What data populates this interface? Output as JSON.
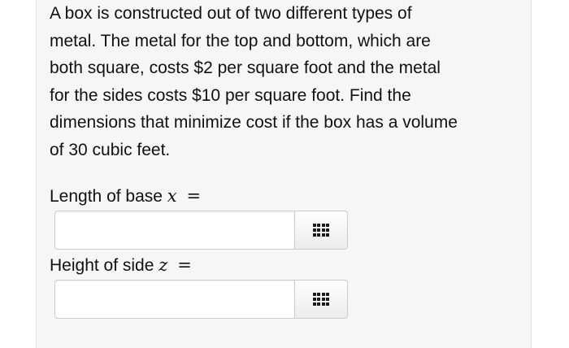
{
  "problem": {
    "text": "A box is constructed out of two different types of\nmetal. The metal for the top and bottom, which are\nboth square, costs $2 per square foot and the metal\nfor the sides costs $10 per square foot. Find the\ndimensions that minimize cost if the box has a volume\nof 30 cubic feet."
  },
  "fields": [
    {
      "label": "Length of base",
      "variable": "x",
      "equals": "=",
      "value": "",
      "placeholder": "",
      "keypad_icon": "keypad-grid-icon"
    },
    {
      "label": "Height of side",
      "variable": "z",
      "equals": "=",
      "value": "",
      "placeholder": "",
      "keypad_icon": "keypad-grid-icon"
    }
  ],
  "colors": {
    "panel_background": "#f6f6f6",
    "input_border": "#cccccc",
    "text": "#111111"
  }
}
